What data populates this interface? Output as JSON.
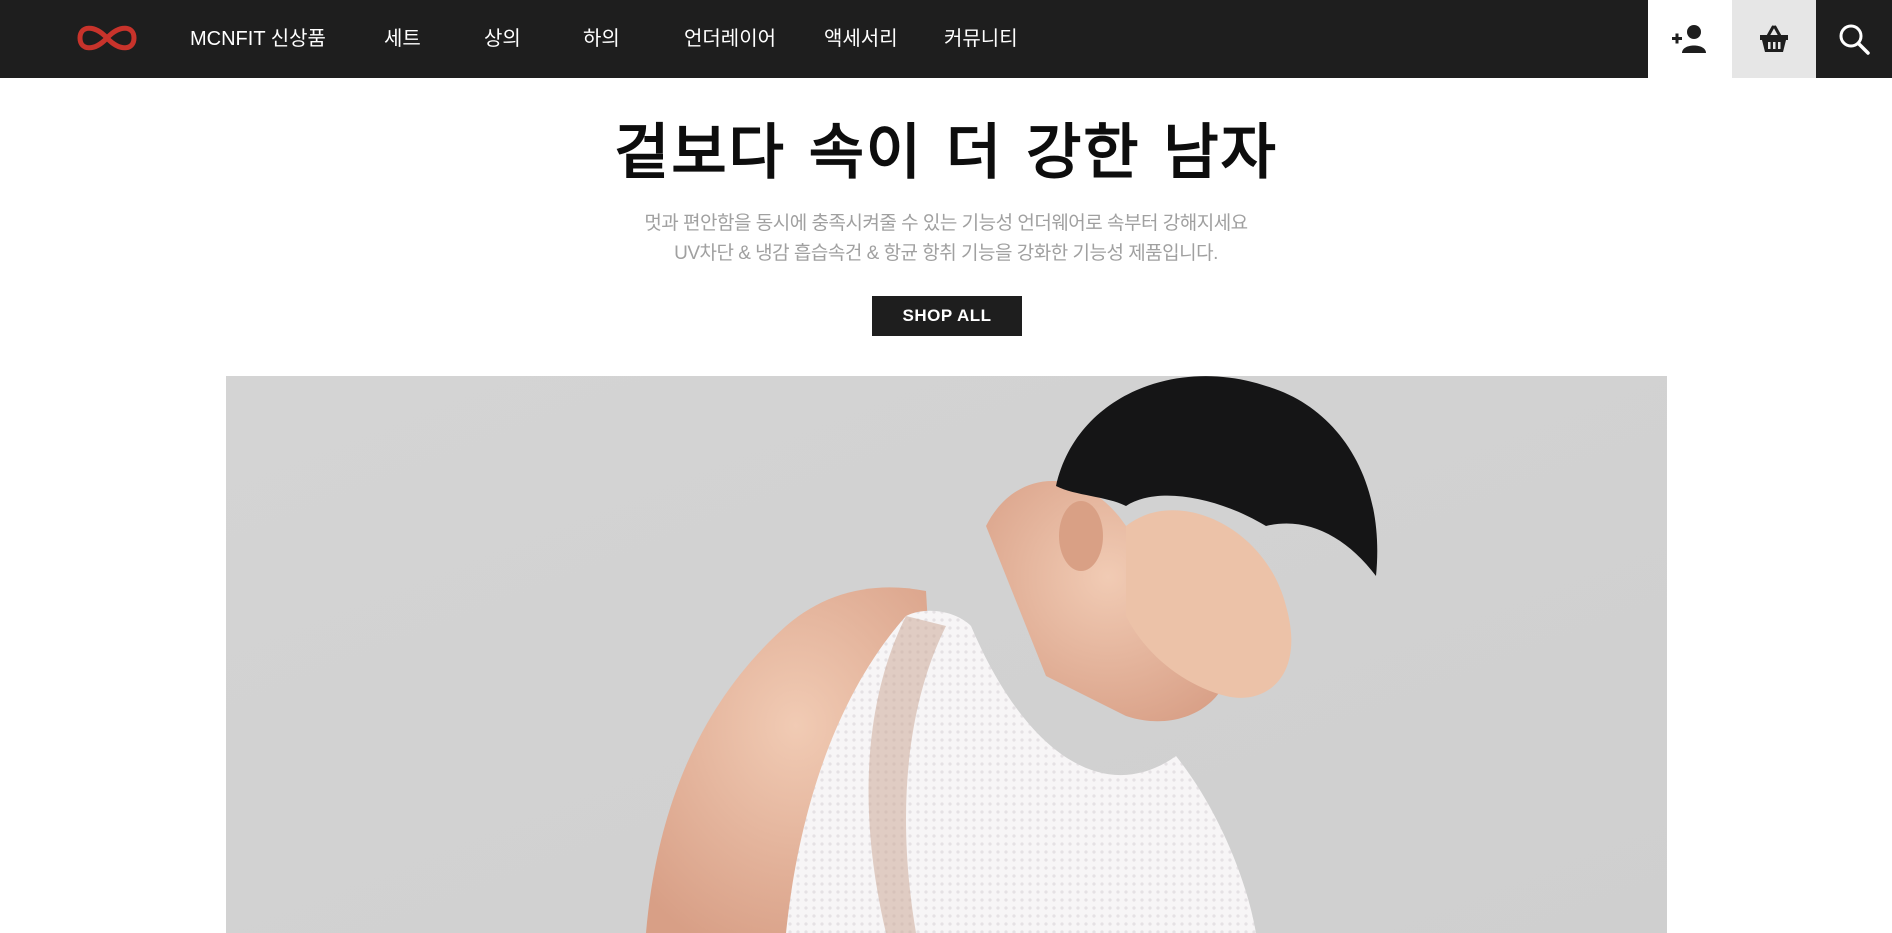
{
  "brand": {
    "logo_icon": "infinity-logo-icon",
    "logo_color": "#c8332b"
  },
  "nav": {
    "items": [
      {
        "label": "MCNFIT 신상품"
      },
      {
        "label": "세트"
      },
      {
        "label": "상의"
      },
      {
        "label": "하의"
      },
      {
        "label": "언더레이어"
      },
      {
        "label": "액세서리"
      },
      {
        "label": "커뮤니티"
      }
    ]
  },
  "utility": {
    "icons": [
      "add-user-icon",
      "basket-icon",
      "search-icon"
    ]
  },
  "hero": {
    "title": "겉보다 속이 더 강한 남자",
    "subtitle_line1": "멋과 편안함을 동시에 충족시켜줄 수 있는 기능성 언더웨어로 속부터 강해지세요",
    "subtitle_line2": "UV차단 & 냉감 흡습속건 & 항균 항취 기능을 강화한 기능성 제품입니다.",
    "cta_label": "SHOP ALL",
    "image_subject": "man-in-white-mesh-tank-top"
  },
  "colors": {
    "header_bg": "#1e1e1e",
    "accent": "#c8332b",
    "subtitle": "#a0a0a0"
  }
}
